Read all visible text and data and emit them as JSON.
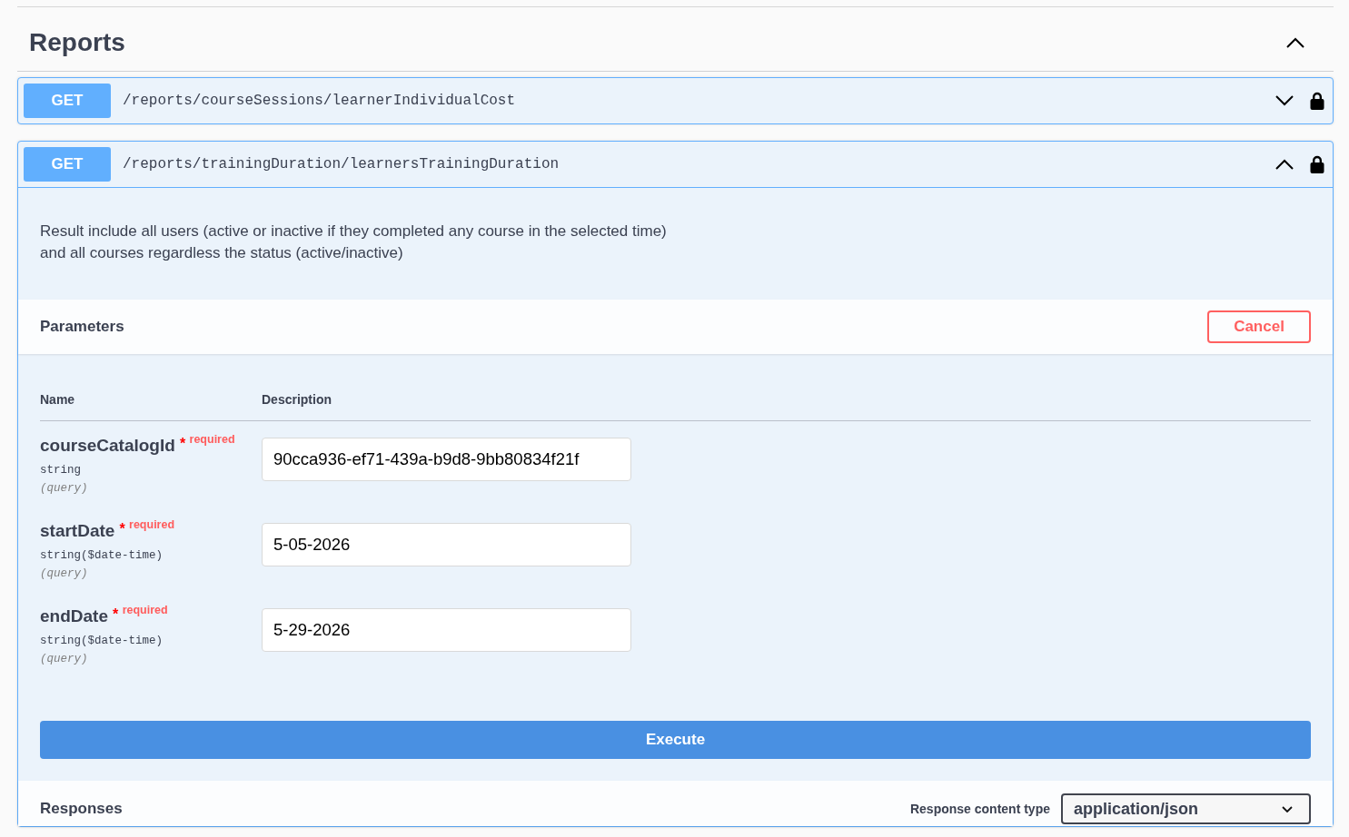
{
  "section": {
    "title": "Reports",
    "expanded": true
  },
  "operations": [
    {
      "method": "GET",
      "path": "/reports/courseSessions/learnerIndividualCost",
      "expanded": false,
      "locked": true
    },
    {
      "method": "GET",
      "path": "/reports/trainingDuration/learnersTrainingDuration",
      "expanded": true,
      "locked": true,
      "description": "Result include all users (active or inactive if they completed any course in the selected time)\nand all courses regardless the status (active/inactive)",
      "parameters": {
        "title": "Parameters",
        "cancel_button": "Cancel",
        "columns": [
          "Name",
          "Description"
        ],
        "rows": [
          {
            "name": "courseCatalogId",
            "required_note": "* $^{required}$",
            "type": "string",
            "location": "(query)",
            "value": "90cca936-ef71-439a-b9d8-9bb80834f21f"
          },
          {
            "name": "startDate",
            "required_note": "* $^{required}$",
            "type": "string($date-time)",
            "location": "(query)",
            "value": "5-05-2026"
          },
          {
            "name": "endDate",
            "required_note": "* $^{required}$",
            "type": "string($date-time)",
            "location": "(query)",
            "value": "5-29-2026"
          }
        ]
      },
      "execute_button": "Execute",
      "responses": {
        "title": "Responses",
        "content_type_label": "Response content type",
        "content_type": "application/json"
      }
    }
  ]
}
